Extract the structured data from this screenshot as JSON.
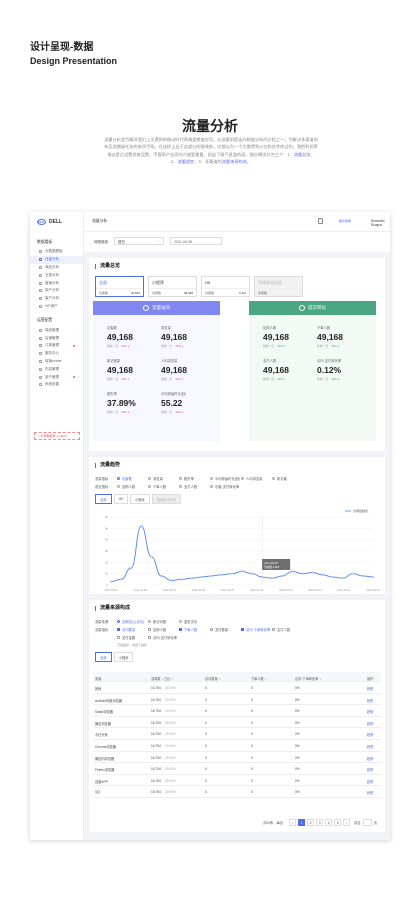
{
  "header": {
    "title_cn": "设计呈现-数据",
    "title_en": "Design Presentation"
  },
  "section": {
    "title": "流量分析",
    "intro_1": "流量分析是为解决我们上次遇到的移动时代两难类数据应用，从流量前提走向数据分析的过程之一，为解决多渠道的有买追赠级任化的各项手段。在这样上业于这部分的搜改前，比都以为一个大量得到以在和技术库过的，我把利润率指这是过设置进取设置，不管再产业而的兴道登重量，组出了服气息盖的面，细分模块分为三个：1、",
    "link_1": "流量总览",
    "intro_2": "、2、",
    "link_2": "流量趋势",
    "intro_3": "、3、多渠道的",
    "link_3": "流量来源构成",
    "intro_4": "。"
  },
  "app": {
    "brand": "DELL",
    "brand_small": "戴尔官网",
    "user": "Kinamfio Ruapol",
    "breadcrumb": "流量分析",
    "sidebar": {
      "group1": "数据看板",
      "items1": [
        {
          "label": "大数据看板",
          "active": false
        },
        {
          "label": "流量分析",
          "active": true
        },
        {
          "label": "商品分析",
          "active": false
        },
        {
          "label": "交易分析",
          "active": false
        },
        {
          "label": "营销分析",
          "active": false
        },
        {
          "label": "用户分析",
          "active": false
        },
        {
          "label": "客户分析",
          "active": false
        },
        {
          "label": "VIP用户",
          "active": false
        }
      ],
      "group2": "运营配置",
      "items2": [
        {
          "label": "商品管理",
          "arrow": "›",
          "dot": false
        },
        {
          "label": "店铺管理",
          "arrow": "›",
          "dot": false
        },
        {
          "label": "订单管理",
          "arrow": "›",
          "dot": true
        },
        {
          "label": "服务中心",
          "arrow": "›",
          "dot": false
        },
        {
          "label": "促销center",
          "arrow": "›",
          "dot": false
        },
        {
          "label": "内容管理",
          "arrow": "›",
          "dot": false
        },
        {
          "label": "用户管理",
          "arrow": "›",
          "dot": true
        },
        {
          "label": "系统设置",
          "arrow": "›",
          "dot": false
        }
      ],
      "footer": "+ 外部数据导入  NEXT"
    },
    "filter": {
      "label": "時間維度",
      "select": "按日",
      "date": "2021-06-08"
    }
  },
  "overview": {
    "title": "流量总览",
    "tabs": [
      {
        "name": "全部",
        "sub": "访客数",
        "val": "46,824",
        "state": "on"
      },
      {
        "name": "小程序",
        "sub": "访客数",
        "val": "38,048",
        "state": ""
      },
      {
        "name": "H5",
        "sub": "访客数",
        "val": "6.2%",
        "state": ""
      },
      {
        "name": "直播渠道流量",
        "sub": "访客数",
        "val": "",
        "state": "dis"
      }
    ],
    "left_head": "流量访问",
    "right_head": "成交转化",
    "left_stats": [
      {
        "k": "访客数",
        "v": "49,168",
        "d": "较前一日",
        "p": "10%",
        "dir": "up"
      },
      {
        "k": "浏览量",
        "v": "49,168",
        "d": "较前一日",
        "p": "10%",
        "dir": "up"
      },
      {
        "k": "新访客数",
        "v": "49,168",
        "d": "较前一日",
        "p": "10%",
        "dir": "dn2"
      },
      {
        "k": "人均浏览量",
        "v": "49,168",
        "d": "较前一日",
        "p": "10%",
        "dir": "dn2"
      },
      {
        "k": "跳失率",
        "v": "37.89%",
        "d": "较前一日",
        "p": "10%",
        "dir": "up"
      },
      {
        "k": "平均停留时长(秒)",
        "v": "55.22",
        "d": "较前一日",
        "p": "10%",
        "dir": "up"
      }
    ],
    "right_stats": [
      {
        "k": "加购人数",
        "v": "49,168",
        "d": "较前一日",
        "p": "10%",
        "dir": "dn"
      },
      {
        "k": "下单人数",
        "v": "49,168",
        "d": "较前一日",
        "p": "10%",
        "dir": "dn"
      },
      {
        "k": "支付人数",
        "v": "49,168",
        "d": "较前一日",
        "p": "10%",
        "dir": "dn"
      },
      {
        "k": "访问-支付转化率",
        "v": "0.12%",
        "d": "较前一日",
        "p": "10%",
        "dir": "dn"
      }
    ]
  },
  "trend": {
    "title": "流量趋势",
    "row1_label": "流量指标",
    "row1": [
      {
        "t": "访客数",
        "on": true
      },
      {
        "t": "浏览量",
        "on": false
      },
      {
        "t": "跳失率",
        "on": false
      },
      {
        "t": "平均停留时长(秒)",
        "on": false
      },
      {
        "t": "人均浏览量",
        "on": false
      },
      {
        "t": "新访客",
        "on": false
      }
    ],
    "row2_label": "成交指标",
    "row2": [
      {
        "t": "加购人数",
        "on": false
      },
      {
        "t": "下单人数",
        "on": false
      },
      {
        "t": "支付人数",
        "on": false
      },
      {
        "t": "访客-支付转化率",
        "on": false
      }
    ],
    "tabs": [
      {
        "t": "全部",
        "s": "on"
      },
      {
        "t": "H5",
        "s": ""
      },
      {
        "t": "小程序",
        "s": ""
      },
      {
        "t": "直播渠道流量",
        "s": "dis"
      }
    ],
    "legend": "访客数趋势",
    "tooltip_date": "2021-06-08",
    "tooltip_val": "访客数 2,000"
  },
  "chart_data": {
    "type": "line",
    "y_ticks": [
      "6k",
      "5k",
      "4k",
      "3k",
      "2k",
      "1k",
      "0"
    ],
    "x_ticks": [
      "2021-03-02",
      "2021-03-09",
      "2021-03-16",
      "2021-03-23",
      "2021-03-30",
      "2021-04-06",
      "2021-04-13",
      "2021-04-20",
      "2021-04-27",
      "2021-05-04"
    ],
    "ylim": [
      0,
      6000
    ],
    "series": [
      {
        "name": "访客数趋势",
        "values": [
          300,
          500,
          1500,
          5200,
          2500,
          800,
          400,
          500,
          600,
          700,
          800,
          900,
          1000,
          1200,
          1000,
          700,
          600,
          800,
          1200,
          1000,
          1100,
          900,
          700,
          600,
          1000,
          800,
          700
        ]
      }
    ]
  },
  "source": {
    "title": "流量来源构成",
    "row1_label": "流量来源",
    "row1": [
      {
        "t": "近期流入(访问)",
        "on": true
      },
      {
        "t": "新访问数",
        "on": false
      },
      {
        "t": "重复访问",
        "on": false
      }
    ],
    "row2_label": "流量指标",
    "row2": [
      {
        "t": "访问数量",
        "on": true
      },
      {
        "t": "加购人数",
        "on": false
      },
      {
        "t": "下单人数",
        "on": true
      },
      {
        "t": "支付数量",
        "on": false
      },
      {
        "t": "访问-下单转化率",
        "on": true
      },
      {
        "t": "支付人数",
        "on": false
      }
    ],
    "row3": [
      {
        "t": "支付金额",
        "on": false
      },
      {
        "t": "访问-支付转化率",
        "on": false
      }
    ],
    "note": "已选指标：共四个指标",
    "tabs": [
      {
        "t": "全部",
        "s": "on"
      },
      {
        "t": "小程序",
        "s": ""
      }
    ],
    "headers": [
      "来源",
      "流量数 ↓ 占比 ↕",
      "访问数量 ↕",
      "下单人数 ↕",
      "访问-下单转化率 ↕",
      "操作"
    ],
    "rows": [
      {
        "src": "其他",
        "num": "16,754",
        "pct": "29.05%",
        "a": "0",
        "b": "0",
        "c": "0%",
        "op": "趋势"
      },
      {
        "src": "Android内置浏览器",
        "num": "16,754",
        "pct": "29.05%",
        "a": "0",
        "b": "0",
        "c": "0%",
        "op": "趋势"
      },
      {
        "src": "Safari浏览器",
        "num": "16,754",
        "pct": "29.05%",
        "a": "0",
        "b": "0",
        "c": "0%",
        "op": "趋势"
      },
      {
        "src": "微信浏览器",
        "num": "16,754",
        "pct": "29.05%",
        "a": "0",
        "b": "0",
        "c": "0%",
        "op": "趋势"
      },
      {
        "src": "今日头条",
        "num": "16,754",
        "pct": "29.05%",
        "a": "0",
        "b": "0",
        "c": "0%",
        "op": "趋势"
      },
      {
        "src": "Chrome浏览器",
        "num": "16,754",
        "pct": "29.05%",
        "a": "0",
        "b": "0",
        "c": "0%",
        "op": "趋势"
      },
      {
        "src": "微信内浏览器",
        "num": "16,754",
        "pct": "29.05%",
        "a": "0",
        "b": "0",
        "c": "0%",
        "op": "趋势"
      },
      {
        "src": "Firefox浏览器",
        "num": "16,754",
        "pct": "29.05%",
        "a": "0",
        "b": "0",
        "c": "0%",
        "op": "趋势"
      },
      {
        "src": "百度APP",
        "num": "16,754",
        "pct": "29.05%",
        "a": "0",
        "b": "0",
        "c": "0%",
        "op": "趋势"
      },
      {
        "src": "QQ",
        "num": "16,754",
        "pct": "29.05%",
        "a": "0",
        "b": "0",
        "c": "0%",
        "op": "趋势"
      }
    ],
    "pager": {
      "info": "共50条，每页",
      "pages": [
        "1",
        "2",
        "3",
        "4",
        "5"
      ],
      "prev": "‹",
      "next": "›",
      "goto": "前往",
      "last": "页"
    }
  }
}
